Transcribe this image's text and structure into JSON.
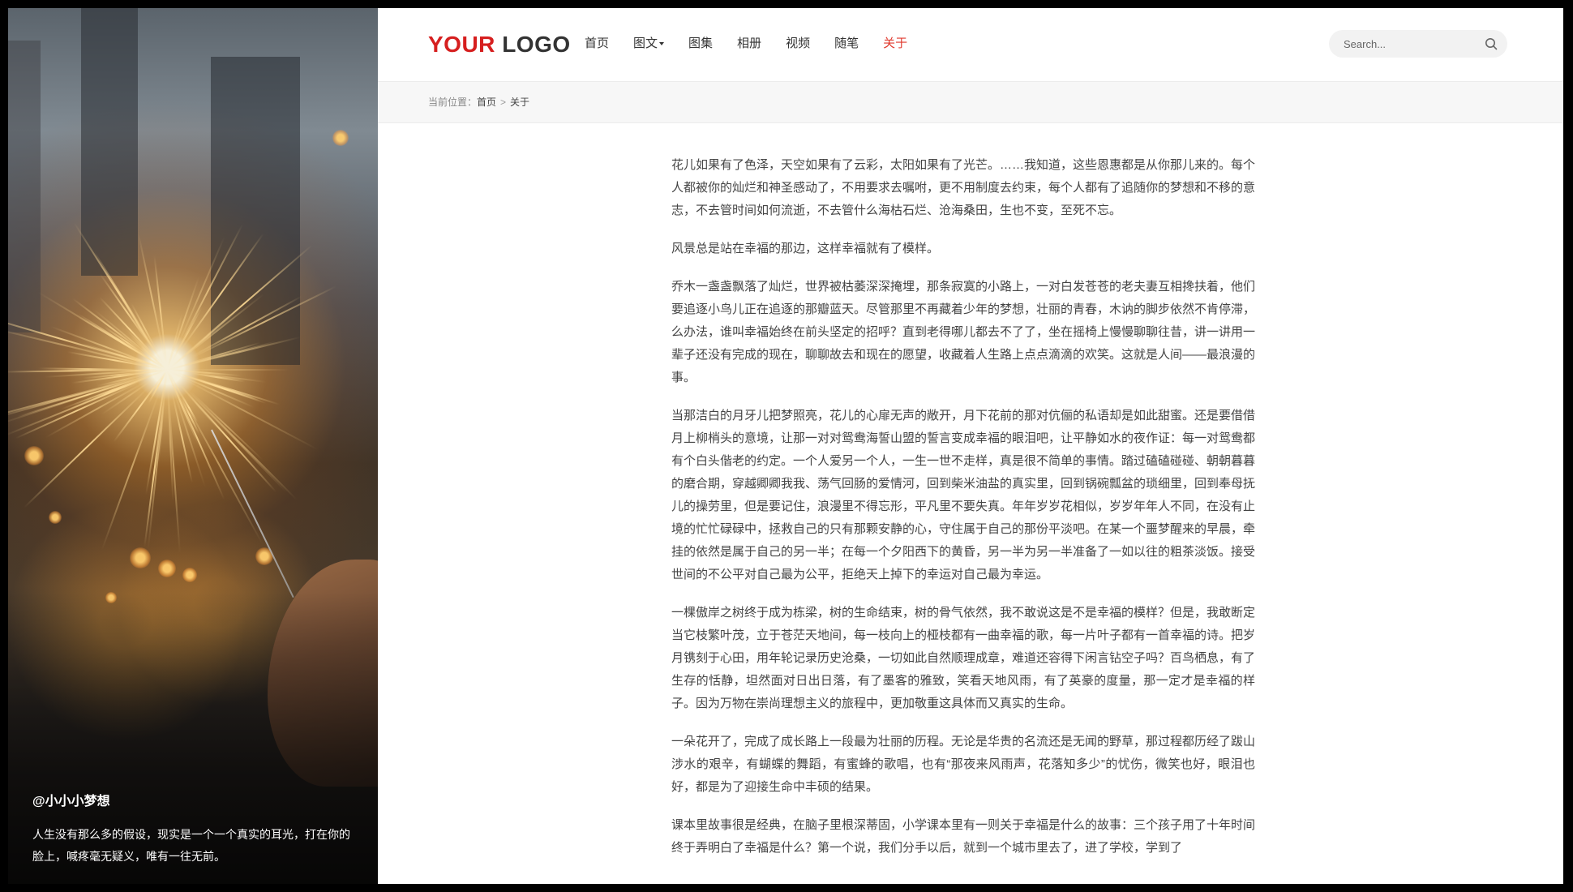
{
  "hero": {
    "author": "@小小小梦想",
    "quote": "人生没有那么多的假设，现实是一个一个真实的耳光，打在你的脸上，喊疼毫无疑义，唯有一往无前。"
  },
  "header": {
    "logo_part1": "YOUR",
    "logo_part2": "LOGO",
    "nav": [
      {
        "label": "首页"
      },
      {
        "label": "图文"
      },
      {
        "label": "图集"
      },
      {
        "label": "相册"
      },
      {
        "label": "视频"
      },
      {
        "label": "随笔"
      },
      {
        "label": "关于"
      }
    ],
    "active_nav": "关于",
    "search_placeholder": "Search..."
  },
  "breadcrumb": {
    "prefix": "当前位置：",
    "items": [
      "首页",
      "关于"
    ],
    "separator": ">"
  },
  "article": {
    "paragraphs": [
      "花儿如果有了色泽，天空如果有了云彩，太阳如果有了光芒。……我知道，这些恩惠都是从你那儿来的。每个人都被你的灿烂和神圣感动了，不用要求去嘱咐，更不用制度去约束，每个人都有了追随你的梦想和不移的意志，不去管时间如何流逝，不去管什么海枯石烂、沧海桑田，生也不变，至死不忘。",
      "风景总是站在幸福的那边，这样幸福就有了模样。",
      "乔木一盏盏飘落了灿烂，世界被枯萎深深掩埋，那条寂寞的小路上，一对白发苍苍的老夫妻互相搀扶着，他们要追逐小鸟儿正在追逐的那瓣蓝天。尽管那里不再藏着少年的梦想，壮丽的青春，木讷的脚步依然不肯停滞，么办法，谁叫幸福始终在前头坚定的招呼？直到老得哪儿都去不了了，坐在摇椅上慢慢聊聊往昔，讲一讲用一辈子还没有完成的现在，聊聊故去和现在的愿望，收藏着人生路上点点滴滴的欢笑。这就是人间——最浪漫的事。",
      "当那洁白的月牙儿把梦照亮，花儿的心扉无声的敞开，月下花前的那对伉俪的私语却是如此甜蜜。还是要借借月上柳梢头的意境，让那一对对鸳鸯海誓山盟的誓言变成幸福的眼泪吧，让平静如水的夜作证：每一对鸳鸯都有个白头偕老的约定。一个人爱另一个人，一生一世不走样，真是很不简单的事情。踏过磕磕碰碰、朝朝暮暮的磨合期，穿越卿卿我我、荡气回肠的爱情河，回到柴米油盐的真实里，回到锅碗瓢盆的琐细里，回到奉母抚儿的操劳里，但是要记住，浪漫里不得忘形，平凡里不要失真。年年岁岁花相似，岁岁年年人不同，在没有止境的忙忙碌碌中，拯救自己的只有那颗安静的心，守住属于自己的那份平淡吧。在某一个噩梦醒来的早晨，牵挂的依然是属于自己的另一半；在每一个夕阳西下的黄昏，另一半为另一半准备了一如以往的粗茶淡饭。接受世间的不公平对自己最为公平，拒绝天上掉下的幸运对自己最为幸运。",
      "一棵傲岸之树终于成为栋梁，树的生命结束，树的骨气依然，我不敢说这是不是幸福的模样？但是，我敢断定当它枝繁叶茂，立于苍茫天地间，每一枝向上的桠枝都有一曲幸福的歌，每一片叶子都有一首幸福的诗。把岁月镌刻于心田，用年轮记录历史沧桑，一切如此自然顺理成章，难道还容得下闲言钻空子吗？百鸟栖息，有了生存的恬静，坦然面对日出日落，有了墨客的雅致，笑看天地风雨，有了英豪的度量，那一定才是幸福的样子。因为万物在崇尚理想主义的旅程中，更加敬重这具体而又真实的生命。",
      "一朵花开了，完成了成长路上一段最为壮丽的历程。无论是华贵的名流还是无闻的野草，那过程都历经了跋山涉水的艰辛，有蝴蝶的舞蹈，有蜜蜂的歌唱，也有“那夜来风雨声，花落知多少”的忧伤，微笑也好，眼泪也好，都是为了迎接生命中丰硕的结果。",
      "课本里故事很是经典，在脑子里根深蒂固，小学课本里有一则关于幸福是什么的故事：三个孩子用了十年时间终于弄明白了幸福是什么？第一个说，我们分手以后，就到一个城市里去了，进了学校，学到了"
    ]
  },
  "colors": {
    "accent": "#e03b2f",
    "logo_red": "#d61f1f",
    "text": "#444444"
  }
}
